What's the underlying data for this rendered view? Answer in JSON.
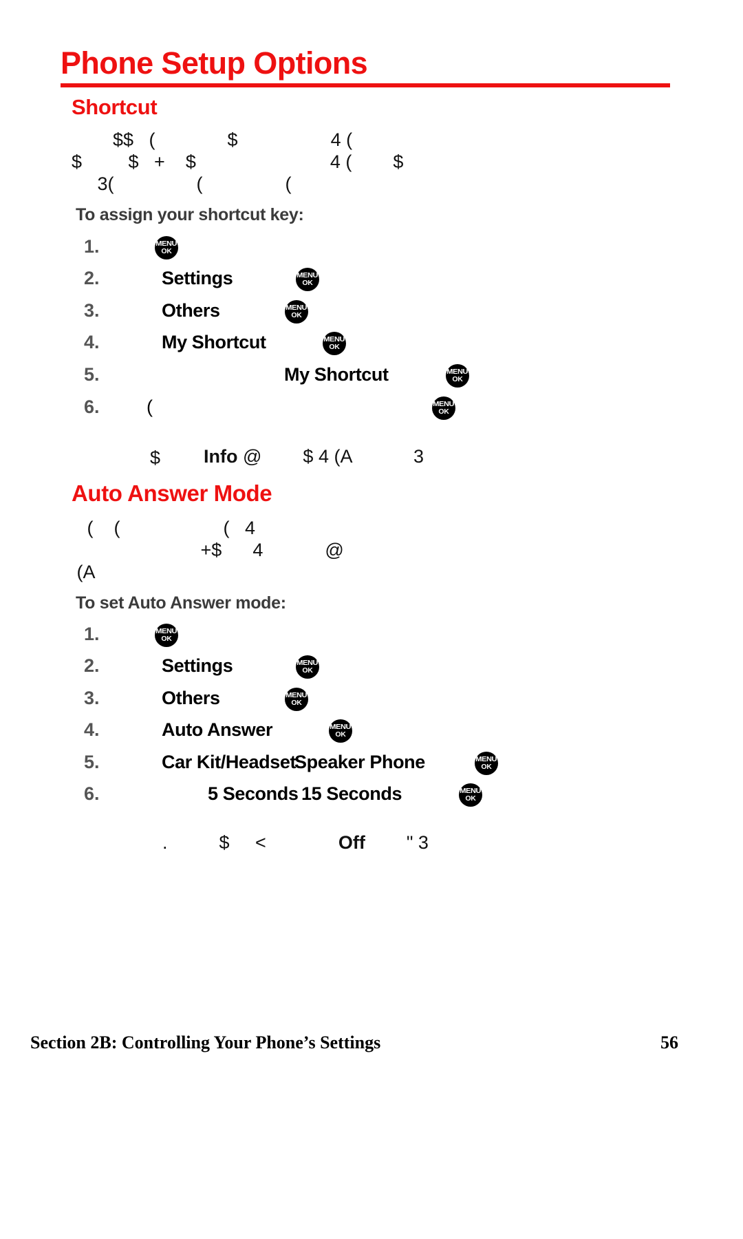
{
  "document": {
    "title": "Phone Setup Options",
    "accent_color": "#ee1111",
    "footer": {
      "section": "Section 2B: Controlling Your Phone’s Settings",
      "page_number": "56"
    }
  },
  "sections": [
    {
      "heading": "Shortcut",
      "body_lines": [
        "        $$   (              $                  4 (",
        "$         $   +    $                          4 (        $",
        "     3(                (                ("
      ],
      "lead_in": "To assign your shortcut key:",
      "steps": [
        {
          "number": "1.",
          "label": "",
          "key": "menu-ok"
        },
        {
          "number": "2.",
          "label": "Settings",
          "key": "menu-ok"
        },
        {
          "number": "3.",
          "label": "Others",
          "key": "menu-ok"
        },
        {
          "number": "4.",
          "label": "My Shortcut",
          "key": "menu-ok"
        },
        {
          "number": "5.",
          "label": "My Shortcut",
          "key": "menu-ok"
        },
        {
          "number": "6.",
          "label": "(",
          "key": "menu-ok"
        }
      ],
      "notes": [
        {
          "bold": "Info",
          "rest": " @        $ 4 (A            3"
        },
        {
          "bold": "",
          "rest": "$"
        }
      ]
    },
    {
      "heading": "Auto Answer Mode",
      "body_lines": [
        "   (    (                    (   4",
        "                         +$      4            @",
        " (A"
      ],
      "lead_in": "To set Auto Answer mode:",
      "steps": [
        {
          "number": "1.",
          "label": "",
          "key": "menu-ok"
        },
        {
          "number": "2.",
          "label": "Settings",
          "key": "menu-ok"
        },
        {
          "number": "3.",
          "label": "Others",
          "key": "menu-ok"
        },
        {
          "number": "4.",
          "label": "Auto Answer",
          "key": "menu-ok"
        },
        {
          "number": "5.",
          "label": "Car Kit/Headset",
          "label2": "Speaker Phone",
          "key": "menu-ok"
        },
        {
          "number": "6.",
          "label": "5 Seconds",
          "label2": "15 Seconds",
          "key": "menu-ok"
        }
      ],
      "notes": [
        {
          "bold": "",
          "rest": ".          $     <              ",
          "bold2": "Off",
          "rest2": "        \" 3"
        }
      ]
    }
  ],
  "key_icon": {
    "top": "MENU",
    "bottom": "OK",
    "name": "menu-ok-key-icon"
  }
}
